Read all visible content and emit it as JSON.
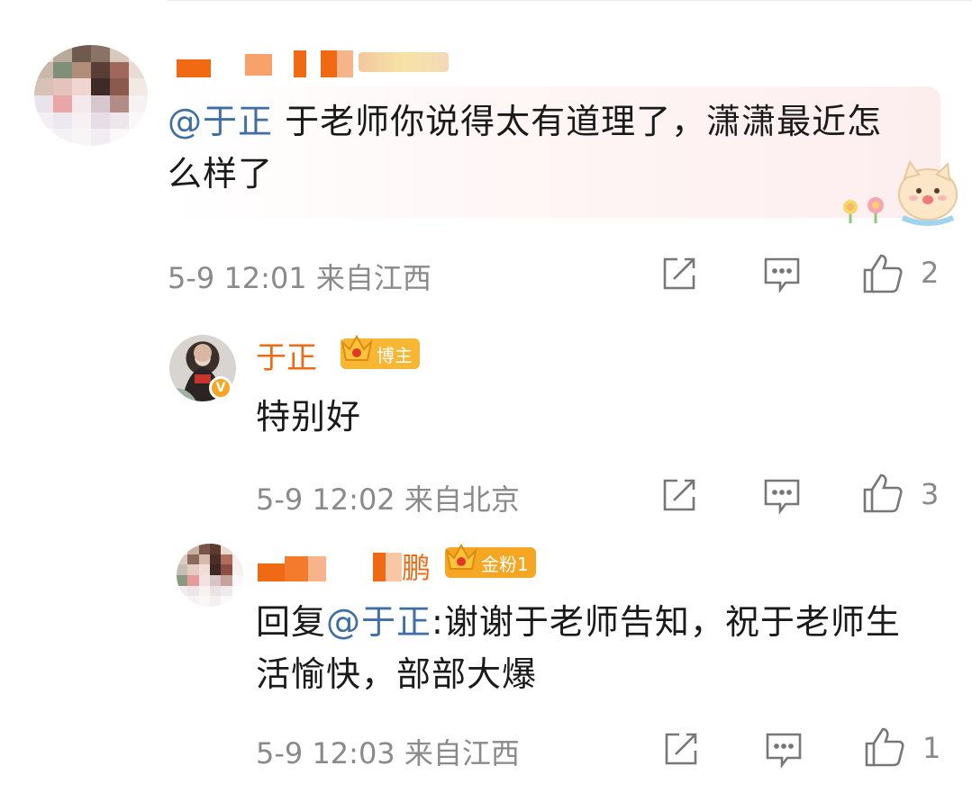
{
  "comments": [
    {
      "author_text": "",
      "mention": "@于正",
      "text": " 于老师你说得太有道理了，潇潇最近怎么样了",
      "time": "5-9 12:01",
      "location": "来自江西",
      "likes": "2"
    }
  ],
  "replies": [
    {
      "author": "于正",
      "badge": "博主",
      "text": "特别好",
      "time": "5-9 12:02",
      "location": "来自北京",
      "likes": "3"
    },
    {
      "author_suffix": "鹏",
      "badge": "金粉1",
      "reply_prefix": "回复",
      "mention": "@于正",
      "text": ":谢谢于老师告知，祝于老师生活愉快，部部大爆",
      "time": "5-9 12:03",
      "location": "来自江西",
      "likes": "1"
    }
  ],
  "icons": {
    "share": "share-edit-icon",
    "comment": "comment-bubble-icon",
    "like": "thumbs-up-icon",
    "badge": "crown-icon",
    "verified": "verified-v-icon"
  },
  "colors": {
    "mention": "#3f6ea3",
    "username": "#f06a13",
    "meta": "#8a8a8a",
    "badge": "#f7b733"
  }
}
